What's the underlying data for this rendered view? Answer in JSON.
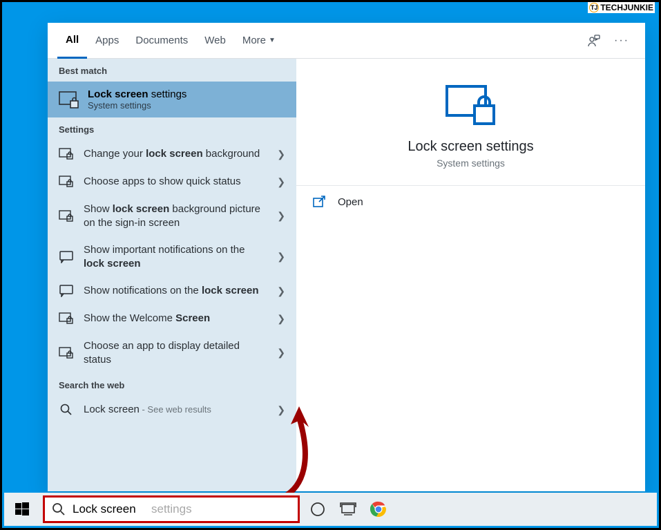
{
  "watermark": {
    "brand_prefix": "TJ",
    "text": "TECHJUNKIE"
  },
  "tabs": {
    "all": "All",
    "apps": "Apps",
    "docs": "Documents",
    "web": "Web",
    "more": "More"
  },
  "sections": {
    "best_match": "Best match",
    "settings": "Settings",
    "web": "Search the web"
  },
  "best_match": {
    "title_bold": "Lock screen",
    "title_rest": " settings",
    "sub": "System settings"
  },
  "settings_items": [
    {
      "pre": "Change your ",
      "bold": "lock screen",
      "post": " background"
    },
    {
      "pre": "Choose apps to show quick status",
      "bold": "",
      "post": ""
    },
    {
      "pre": "Show ",
      "bold": "lock screen",
      "post": " background picture on the sign-in screen"
    },
    {
      "pre": "Show important notifications on the ",
      "bold": "lock screen",
      "post": ""
    },
    {
      "pre": "Show notifications on the ",
      "bold": "lock screen",
      "post": ""
    },
    {
      "pre": "Show the Welcome ",
      "bold": "Screen",
      "post": ""
    },
    {
      "pre": "Choose an app to display detailed status",
      "bold": "",
      "post": ""
    }
  ],
  "web_item": {
    "pre": "Lock screen",
    "sub": " - See web results"
  },
  "preview": {
    "title": "Lock screen settings",
    "sub": "System settings"
  },
  "actions": {
    "open": "Open"
  },
  "search": {
    "value": "Lock screen",
    "hint": "settings"
  }
}
